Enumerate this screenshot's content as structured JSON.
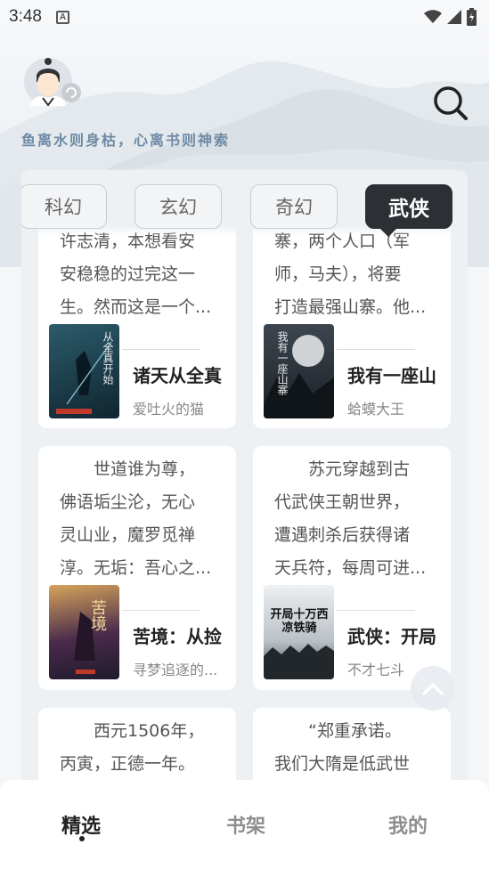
{
  "status_bar": {
    "time": "3:48",
    "notification_icon": "A"
  },
  "header": {
    "slogan": "鱼离水则身枯，心离书则神索"
  },
  "tabs": [
    {
      "label": "科幻",
      "active": false
    },
    {
      "label": "玄幻",
      "active": false
    },
    {
      "label": "奇幻",
      "active": false
    },
    {
      "label": "武侠",
      "active": true
    }
  ],
  "cards": [
    {
      "desc_lines": [
        "许志清，本想看安",
        "安稳稳的过完这一",
        "生。然而这是一个..."
      ],
      "title": "诸天从全真",
      "author": "爱吐火的猫",
      "cover_text": "从全真开始",
      "cover_color": "#1e3d4c"
    },
    {
      "desc_lines": [
        "寨，两个人口（军",
        "师，马夫），将要",
        "打造最强山寨。他..."
      ],
      "title": "我有一座山",
      "author": "蛤蟆大王",
      "cover_text": "我有一座山寨",
      "cover_color": "#2b3138"
    },
    {
      "desc_lines": [
        "　　世道谁为尊，",
        "佛语垢尘沦，无心",
        "灵山业，魔罗觅禅",
        "淳。无垢：吾心之..."
      ],
      "title": "苦境：从捡",
      "author": "寻梦追逐的...",
      "cover_text": "苦境",
      "cover_color": "#3a2a3c"
    },
    {
      "desc_lines": [
        "　　苏元穿越到古",
        "代武侠王朝世界，",
        "遭遇刺杀后获得诸",
        "天兵符，每周可进..."
      ],
      "title": "武侠：开局",
      "author": "不才七斗",
      "cover_text": "开局十万西凉铁骑",
      "cover_color": "#dfe3e6"
    },
    {
      "desc_lines": [
        "　　西元1506年，",
        "丙寅，正德一年。"
      ],
      "title": "",
      "author": "",
      "cover_text": "",
      "cover_color": ""
    },
    {
      "desc_lines": [
        "　　“郑重承诺。",
        "我们大隋是低武世"
      ],
      "title": "",
      "author": "",
      "cover_text": "",
      "cover_color": ""
    }
  ],
  "bottom_nav": [
    {
      "label": "精选",
      "active": true
    },
    {
      "label": "书架",
      "active": false
    },
    {
      "label": "我的",
      "active": false
    }
  ]
}
